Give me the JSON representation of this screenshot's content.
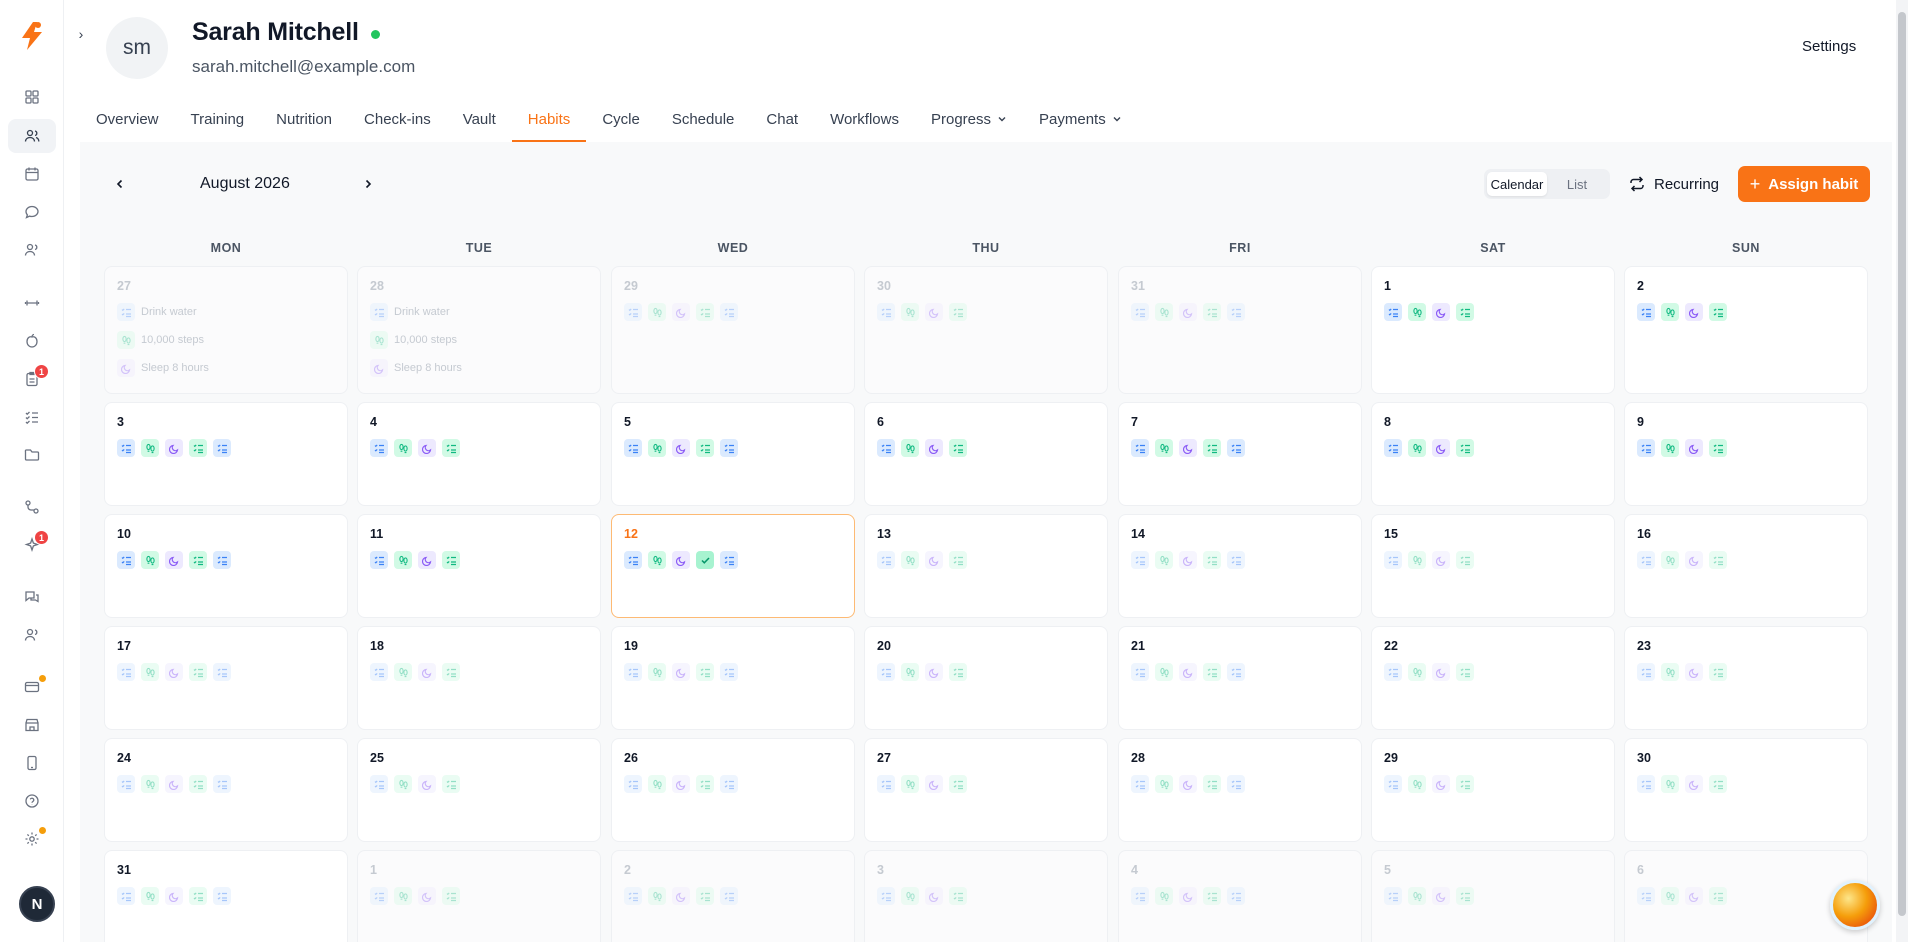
{
  "client": {
    "initials": "sm",
    "name": "Sarah Mitchell",
    "email": "sarah.mitchell@example.com"
  },
  "header": {
    "settings_label": "Settings"
  },
  "sidebar": {
    "logo": "bolt-logo",
    "badge_1": "1",
    "badge_2": "1",
    "user_initial": "N"
  },
  "tabs": [
    {
      "label": "Overview"
    },
    {
      "label": "Training"
    },
    {
      "label": "Nutrition"
    },
    {
      "label": "Check-ins"
    },
    {
      "label": "Vault"
    },
    {
      "label": "Habits"
    },
    {
      "label": "Cycle"
    },
    {
      "label": "Schedule"
    },
    {
      "label": "Chat"
    },
    {
      "label": "Workflows"
    },
    {
      "label": "Progress"
    },
    {
      "label": "Payments"
    }
  ],
  "calendar": {
    "month_label": "August 2026",
    "view_calendar": "Calendar",
    "view_list": "List",
    "recurring_label": "Recurring",
    "assign_label": "Assign habit",
    "weekdays": [
      "MON",
      "TUE",
      "WED",
      "THU",
      "FRI",
      "SAT",
      "SUN"
    ],
    "habit_labels": [
      "Drink water",
      "10,000 steps",
      "Sleep 8 hours"
    ]
  },
  "colors": {
    "accent": "#f97316",
    "online": "#22c55e",
    "badge": "#ef4444"
  }
}
